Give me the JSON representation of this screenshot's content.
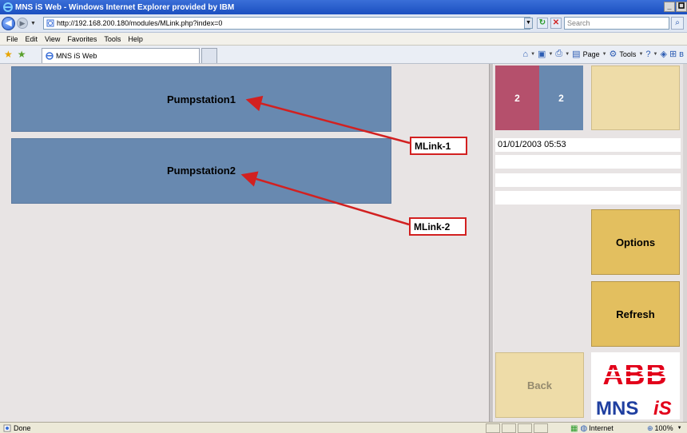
{
  "window": {
    "title": "MNS iS Web - Windows Internet Explorer provided by IBM",
    "min_glyph": "_",
    "max_glyph": " "
  },
  "address": {
    "url": "http://192.168.200.180/modules/MLink.php?index=0",
    "search_placeholder": "Search"
  },
  "menu": {
    "items": [
      "File",
      "Edit",
      "View",
      "Favorites",
      "Tools",
      "Help"
    ]
  },
  "tab": {
    "title": "MNS iS Web"
  },
  "command_bar": {
    "page_label": "Page",
    "tools_label": "Tools"
  },
  "main": {
    "pumpstations": [
      "Pumpstation1",
      "Pumpstation2"
    ],
    "annotations": [
      "MLink-1",
      "MLink-2"
    ]
  },
  "sidebar": {
    "counter_a": "2",
    "counter_b": "2",
    "datetime": "01/01/2003 05:53",
    "options_label": "Options",
    "refresh_label": "Refresh",
    "back_label": "Back",
    "logo_top": "ABB",
    "logo_bottom_mns": "MNS",
    "logo_bottom_is": "iS"
  },
  "status": {
    "text": "Done",
    "zone": "Internet",
    "zoom": "100%"
  },
  "colors": {
    "pump_blue": "#6889b0",
    "counter_red": "#b5506c",
    "gold_button": "#e3bf5f",
    "pale_button": "#eedca8",
    "annotation_red": "#d22020",
    "abb_red": "#e2001a",
    "abb_blue": "#1f3fa0"
  },
  "icons": {
    "back": "back-arrow-icon",
    "forward": "forward-arrow-icon",
    "refresh": "refresh-icon",
    "stop": "stop-icon",
    "search": "search-icon",
    "favorites": "favorites-star-icon",
    "home": "home-icon",
    "print": "print-icon"
  }
}
